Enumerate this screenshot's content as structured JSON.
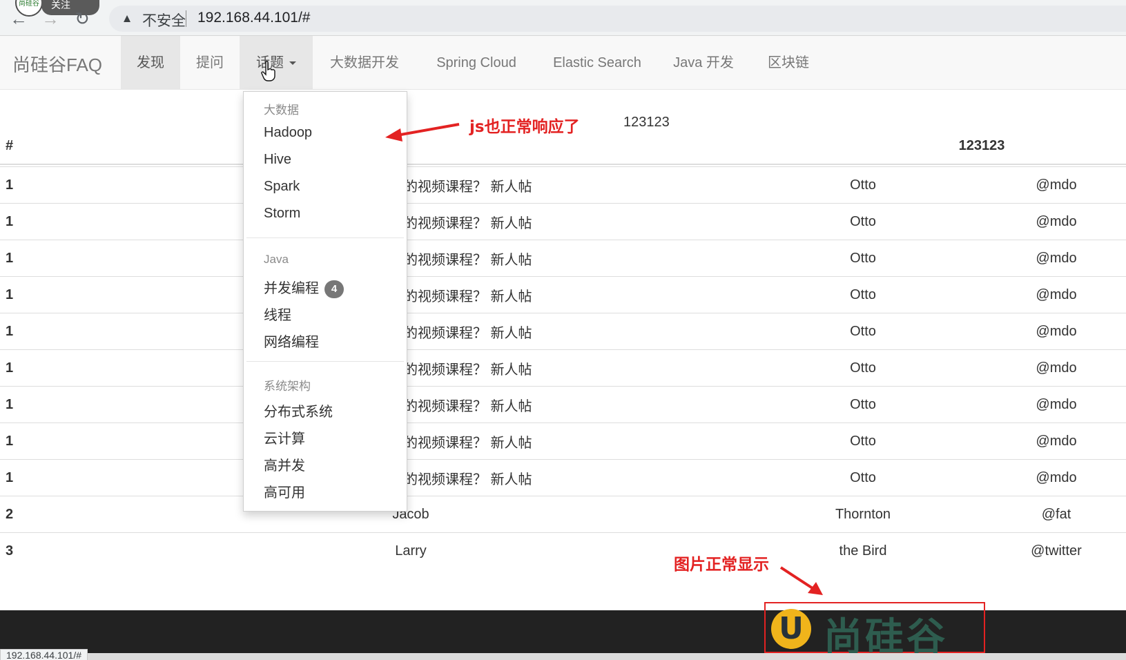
{
  "browser": {
    "tab_avatar_text": "尚硅谷",
    "tab_label": "关注",
    "back_icon": "arrow-left-icon",
    "forward_icon": "arrow-right-icon",
    "reload_icon": "reload-icon",
    "security_label": "不安全",
    "url": "192.168.44.101/#",
    "status_url": "192.168.44.101/#"
  },
  "navbar": {
    "brand": "尚硅谷FAQ",
    "items": [
      {
        "label": "发现"
      },
      {
        "label": "提问"
      },
      {
        "label": "话题"
      },
      {
        "label": "大数据开发"
      },
      {
        "label": "Spring Cloud"
      },
      {
        "label": "Elastic Search"
      },
      {
        "label": "Java 开发"
      },
      {
        "label": "区块链"
      }
    ]
  },
  "dropdown": {
    "groups": [
      {
        "header": "大数据",
        "items": [
          {
            "label": "Hadoop"
          },
          {
            "label": "Hive"
          },
          {
            "label": "Spark"
          },
          {
            "label": "Storm"
          }
        ]
      },
      {
        "header": "Java",
        "items": [
          {
            "label": "并发编程",
            "badge": "4"
          },
          {
            "label": "线程"
          },
          {
            "label": "网络编程"
          }
        ]
      },
      {
        "header": "系统架构",
        "items": [
          {
            "label": "分布式系统"
          },
          {
            "label": "云计算"
          },
          {
            "label": "高并发"
          },
          {
            "label": "高可用"
          }
        ]
      }
    ]
  },
  "content": {
    "extra_text": "123123",
    "table": {
      "headers": [
        "#",
        "123123"
      ],
      "rows": [
        {
          "idx": "1",
          "first": "的视频课程？ 新人帖",
          "last": "Otto",
          "user": "@mdo"
        },
        {
          "idx": "1",
          "first": "的视频课程？ 新人帖",
          "last": "Otto",
          "user": "@mdo"
        },
        {
          "idx": "1",
          "first": "的视频课程？ 新人帖",
          "last": "Otto",
          "user": "@mdo"
        },
        {
          "idx": "1",
          "first": "的视频课程？ 新人帖",
          "last": "Otto",
          "user": "@mdo"
        },
        {
          "idx": "1",
          "first": "的视频课程？ 新人帖",
          "last": "Otto",
          "user": "@mdo"
        },
        {
          "idx": "1",
          "first": "的视频课程？ 新人帖",
          "last": "Otto",
          "user": "@mdo"
        },
        {
          "idx": "1",
          "first": "的视频课程？ 新人帖",
          "last": "Otto",
          "user": "@mdo"
        },
        {
          "idx": "1",
          "first": "的视频课程？ 新人帖",
          "last": "Otto",
          "user": "@mdo"
        },
        {
          "idx": "1",
          "first": "的视频课程？ 新人帖",
          "last": "Otto",
          "user": "@mdo"
        },
        {
          "idx": "2",
          "first": "Jacob",
          "last": "Thornton",
          "user": "@fat"
        },
        {
          "idx": "3",
          "first": "Larry",
          "last": "the Bird",
          "user": "@twitter"
        }
      ]
    }
  },
  "annotations": {
    "js_note": "js也正常响应了",
    "img_note": "图片正常显示",
    "color": "#e32222"
  },
  "footer": {
    "logo_mark": "U",
    "logo_text": "尚硅谷"
  }
}
